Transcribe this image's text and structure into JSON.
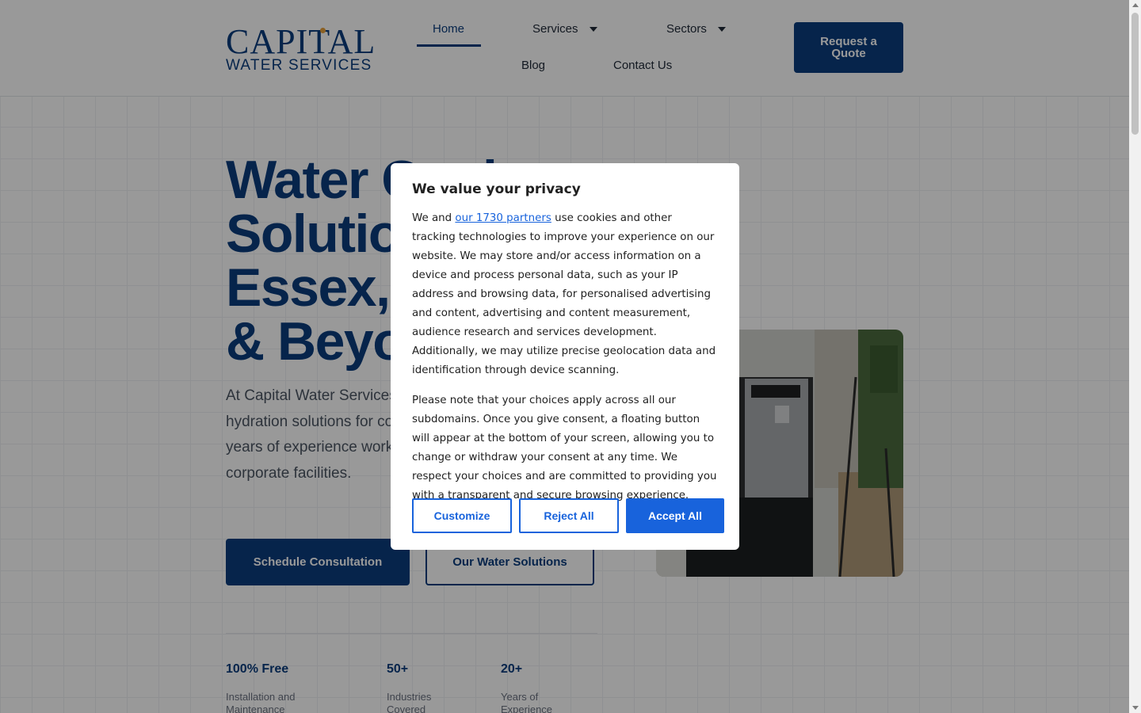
{
  "header": {
    "logo_top": "CAPITAL",
    "logo_bottom": "WATER SERVICES",
    "nav": {
      "home": "Home",
      "services": "Services",
      "sectors": "Sectors",
      "blog": "Blog",
      "contact": "Contact Us"
    },
    "cta": "Request a Quote"
  },
  "hero": {
    "title_lines": [
      "Water Cooler",
      "Solutions in",
      "Essex,",
      "& Beyond"
    ],
    "text": "At Capital Water Services, we provide water coolers and hydration solutions for commercial environments, with years of experience working with businesses and corporate facilities.",
    "primary_button": "Schedule Consultation",
    "secondary_button": "Our Water Solutions"
  },
  "stats": [
    {
      "value": "100% Free",
      "label": "Installation and Maintenance"
    },
    {
      "value": "50+",
      "label": "Industries Covered"
    },
    {
      "value": "20+",
      "label": "Years of Experience"
    }
  ],
  "consent": {
    "title": "We value your privacy",
    "p1_before": "We and ",
    "p1_link": "our 1730 partners",
    "p1_after": " use cookies and other tracking technologies to improve your experience on our website. We may store and/or access information on a device and process personal data, such as your IP address and browsing data, for personalised advertising and content, advertising and content measurement, audience research and services development. Additionally, we may utilize precise geolocation data and identification through device scanning.",
    "p2": "Please note that your choices apply across all our subdomains. Once you give consent, a floating button will appear at the bottom of your screen, allowing you to change or withdraw your consent at any time. We respect your choices and are committed to providing you with a transparent and secure browsing experience.",
    "customize": "Customize",
    "reject": "Reject All",
    "accept": "Accept All"
  },
  "colors": {
    "brand": "#0a3d7e",
    "consent_accent": "#1863dc",
    "logo_dot": "#e8a03a"
  }
}
